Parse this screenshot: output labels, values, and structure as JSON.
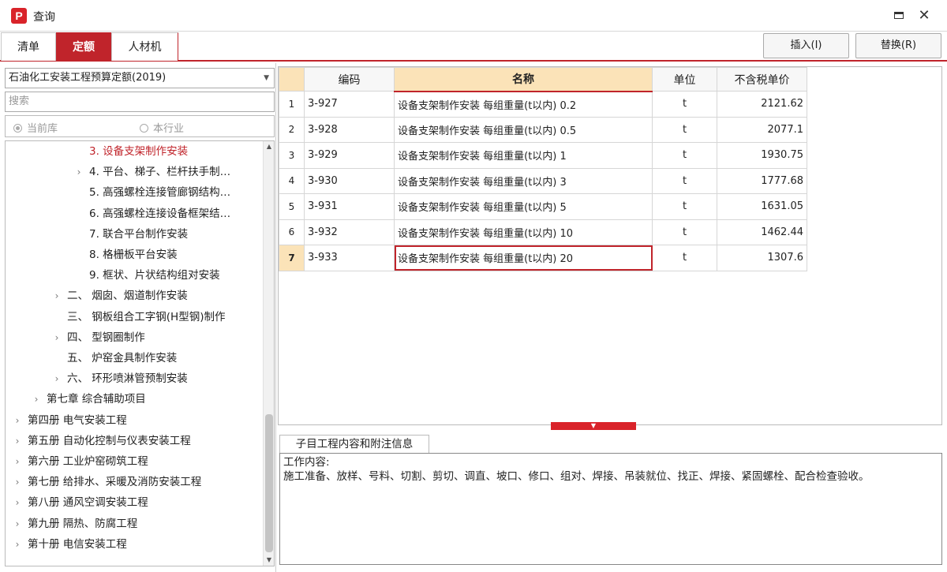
{
  "window": {
    "logo": "P",
    "title": "查询",
    "maximize": "□",
    "close": "✕"
  },
  "tabs": [
    {
      "label": "清单",
      "active": false
    },
    {
      "label": "定额",
      "active": true
    },
    {
      "label": "人材机",
      "active": false
    }
  ],
  "toolbar": {
    "insert_label": "插入(I)",
    "replace_label": "替换(R)"
  },
  "left": {
    "library": "石油化工安装工程预算定额(2019)",
    "search_placeholder": "搜索",
    "radio": [
      {
        "label": "当前库",
        "checked": true
      },
      {
        "label": "本行业",
        "checked": false
      }
    ],
    "tree": [
      {
        "label": "3. 设备支架制作安装",
        "indent": 3,
        "chevron": "",
        "active": true
      },
      {
        "label": "4. 平台、梯子、栏杆扶手制…",
        "indent": 3,
        "chevron": "›",
        "active": false
      },
      {
        "label": "5. 高强螺栓连接管廊钢结构…",
        "indent": 3,
        "chevron": "",
        "active": false
      },
      {
        "label": "6. 高强螺栓连接设备框架结…",
        "indent": 3,
        "chevron": "",
        "active": false
      },
      {
        "label": "7. 联合平台制作安装",
        "indent": 3,
        "chevron": "",
        "active": false
      },
      {
        "label": "8. 格栅板平台安装",
        "indent": 3,
        "chevron": "",
        "active": false
      },
      {
        "label": "9. 框状、片状结构组对安装",
        "indent": 3,
        "chevron": "",
        "active": false
      },
      {
        "label": "二、 烟囱、烟道制作安装",
        "indent": 2,
        "chevron": "›",
        "active": false
      },
      {
        "label": "三、 钢板组合工字钢(H型钢)制作",
        "indent": 2,
        "chevron": "",
        "active": false
      },
      {
        "label": "四、 型钢圈制作",
        "indent": 2,
        "chevron": "›",
        "active": false
      },
      {
        "label": "五、 炉窑金具制作安装",
        "indent": 2,
        "chevron": "",
        "active": false
      },
      {
        "label": "六、 环形喷淋管预制安装",
        "indent": 2,
        "chevron": "›",
        "active": false
      },
      {
        "label": "第七章 综合辅助项目",
        "indent": 1,
        "chevron": "›",
        "active": false
      },
      {
        "label": "第四册 电气安装工程",
        "indent": 0,
        "chevron": "›",
        "active": false
      },
      {
        "label": "第五册 自动化控制与仪表安装工程",
        "indent": 0,
        "chevron": "›",
        "active": false
      },
      {
        "label": "第六册 工业炉窑砌筑工程",
        "indent": 0,
        "chevron": "›",
        "active": false
      },
      {
        "label": "第七册 给排水、采暖及消防安装工程",
        "indent": 0,
        "chevron": "›",
        "active": false
      },
      {
        "label": "第八册 通风空调安装工程",
        "indent": 0,
        "chevron": "›",
        "active": false
      },
      {
        "label": "第九册 隔热、防腐工程",
        "indent": 0,
        "chevron": "›",
        "active": false
      },
      {
        "label": "第十册 电信安装工程",
        "indent": 0,
        "chevron": "›",
        "active": false
      }
    ]
  },
  "grid": {
    "columns": [
      "编码",
      "名称",
      "单位",
      "不含税单价"
    ],
    "rows": [
      {
        "num": "1",
        "code": "3-927",
        "name": "设备支架制作安装 每组重量(t以内) 0.2",
        "unit": "t",
        "price": "2121.62"
      },
      {
        "num": "2",
        "code": "3-928",
        "name": "设备支架制作安装 每组重量(t以内) 0.5",
        "unit": "t",
        "price": "2077.1"
      },
      {
        "num": "3",
        "code": "3-929",
        "name": "设备支架制作安装 每组重量(t以内) 1",
        "unit": "t",
        "price": "1930.75"
      },
      {
        "num": "4",
        "code": "3-930",
        "name": "设备支架制作安装 每组重量(t以内) 3",
        "unit": "t",
        "price": "1777.68"
      },
      {
        "num": "5",
        "code": "3-931",
        "name": "设备支架制作安装 每组重量(t以内) 5",
        "unit": "t",
        "price": "1631.05"
      },
      {
        "num": "6",
        "code": "3-932",
        "name": "设备支架制作安装 每组重量(t以内) 10",
        "unit": "t",
        "price": "1462.44"
      },
      {
        "num": "7",
        "code": "3-933",
        "name": "设备支架制作安装 每组重量(t以内) 20",
        "unit": "t",
        "price": "1307.6"
      }
    ],
    "selected_row": 6
  },
  "info": {
    "tab_label": "子目工程内容和附注信息",
    "line1": "工作内容:",
    "line2": "施工准备、放样、号料、切割、剪切、调直、坡口、修口、组对、焊接、吊装就位、找正、焊接、紧固螺栓、配合检查验收。"
  },
  "colors": {
    "accent": "#c0242b",
    "highlight": "#fbe3b8"
  }
}
